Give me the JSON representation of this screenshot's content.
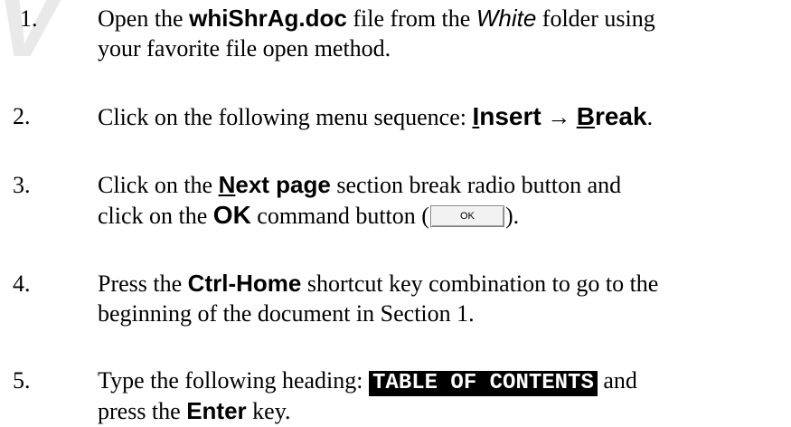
{
  "watermark": "V",
  "steps": [
    {
      "number": "1.",
      "line1_pre": "Open the ",
      "filename": "whiShrAg.doc",
      "line1_mid": " file from the ",
      "folder": "White",
      "line1_post": " folder using",
      "line2": "your favorite file open method."
    },
    {
      "number": "2.",
      "pre": "Click on the following menu sequence:  ",
      "menu1_key": "I",
      "menu1_rest": "nsert",
      "arrow": " → ",
      "menu2_key": "B",
      "menu2_rest": "reak",
      "post": "."
    },
    {
      "number": "3.",
      "line1_pre": "Click on the ",
      "option_key": "N",
      "option_rest": "ext page",
      "line1_post": " section break radio button and",
      "line2_pre": "click on the ",
      "ok_label": "OK",
      "line2_mid": " command button (",
      "button_text": "OK",
      "line2_post": ")."
    },
    {
      "number": "4.",
      "line1_pre": "Press the ",
      "shortcut": "Ctrl-Home",
      "line1_post": " shortcut key combination to go to the",
      "line2": "beginning of the document in Section 1."
    },
    {
      "number": "5.",
      "line1_pre": "Type the following heading:  ",
      "heading": "TABLE OF CONTENTS",
      "line1_post": " and",
      "line2_pre": "press the ",
      "key": "Enter",
      "line2_post": " key."
    }
  ]
}
